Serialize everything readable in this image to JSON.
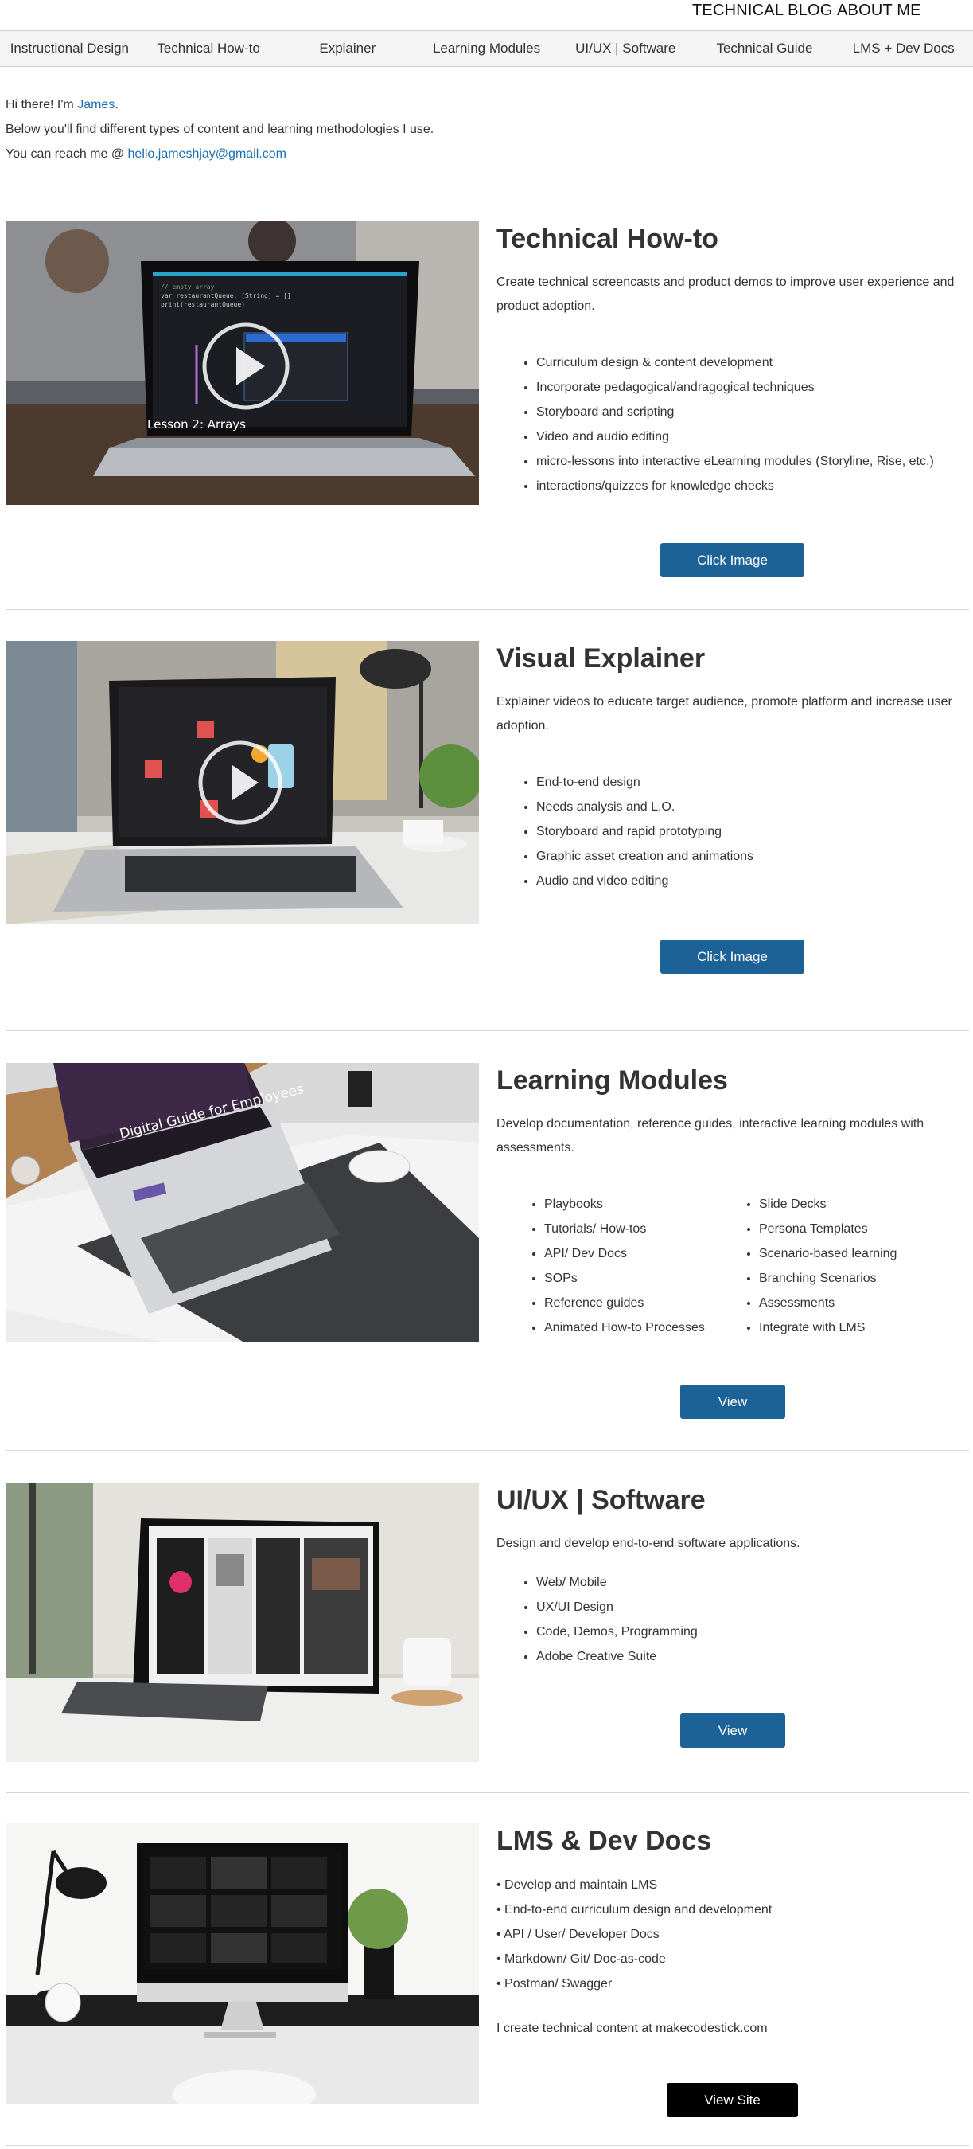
{
  "topnav": {
    "blog": "TECHNICAL BLOG",
    "about": "ABOUT ME"
  },
  "tabs": [
    "Instructional Design",
    "Technical How-to",
    "Explainer",
    "Learning Modules",
    "UI/UX | Software",
    "Technical Guide",
    "LMS + Dev Docs"
  ],
  "intro": {
    "greeting_prefix": "Hi there! I'm ",
    "name": "James",
    "greeting_suffix": ".",
    "line2": "Below you'll find different types of content and learning methodologies I use.",
    "contact_prefix": "You can reach me @ ",
    "email": "hello.jameshjay@gmail.com"
  },
  "howto": {
    "title": "Technical How-to",
    "desc": "Create technical screencasts and product demos to improve user experience and product adoption.",
    "items": [
      "Curriculum design & content development",
      "Incorporate pedagogical/andragogical techniques",
      "Storyboard and scripting",
      "Video and audio editing",
      "micro-lessons into interactive eLearning modules  (Storyline, Rise, etc.)",
      "interactions/quizzes for knowledge checks"
    ],
    "button": "Click Image",
    "screen_caption": "Lesson 2: Arrays"
  },
  "explainer": {
    "title": "Visual Explainer",
    "desc": "Explainer videos to educate target audience, promote platform and increase user adoption.",
    "items": [
      "End-to-end design",
      "Needs analysis and L.O.",
      "Storyboard and rapid prototyping",
      "Graphic asset creation and animations",
      "Audio and video editing"
    ],
    "button": "Click Image"
  },
  "modules": {
    "title": "Learning Modules",
    "desc": "Develop documentation, reference guides, interactive learning modules with assessments.",
    "col1": [
      "Playbooks",
      "Tutorials/ How-tos",
      "API/ Dev Docs",
      "SOPs",
      "Reference guides",
      "Animated How-to Processes"
    ],
    "col2": [
      "Slide Decks",
      "Persona Templates",
      "Scenario-based learning",
      "Branching Scenarios",
      "Assessments",
      "Integrate with LMS"
    ],
    "button": "View",
    "screen_caption": "Digital Guide for Employees"
  },
  "uiux": {
    "title": "UI/UX | Software",
    "desc": "Design and develop end-to-end software applications.",
    "items": [
      "Web/ Mobile",
      "UX/UI Design",
      "Code, Demos, Programming",
      "Adobe Creative Suite"
    ],
    "button": "View"
  },
  "lms": {
    "title": "LMS & Dev Docs",
    "items": [
      "• Develop and maintain LMS",
      "• End-to-end curriculum design and development",
      "• API / User/ Developer Docs",
      "• Markdown/ Git/ Doc-as-code",
      "• Postman/ Swagger"
    ],
    "footer": "I create technical content at makecodestick.com",
    "button": "View Site"
  },
  "colors": {
    "button": "#1c6296",
    "button_dark": "#000000",
    "link": "#1a6fb3",
    "divider": "#d6d6d6"
  }
}
